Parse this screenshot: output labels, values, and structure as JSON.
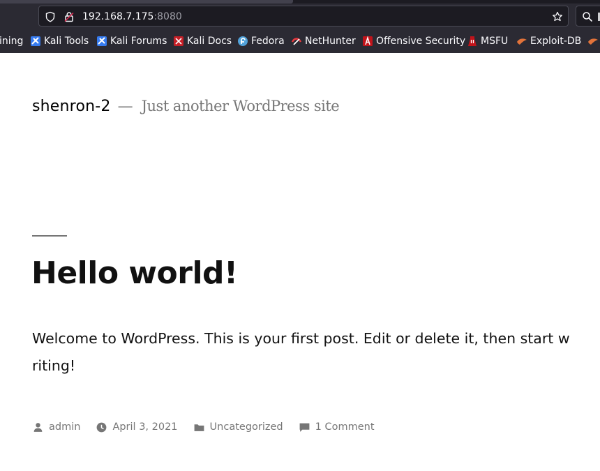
{
  "browser": {
    "url_host": "192.168.7.175",
    "url_port": ":8080",
    "bookmarks": [
      {
        "label": "ining",
        "icon": "kali-training-icon"
      },
      {
        "label": "Kali Tools",
        "icon": "kali-tools-icon"
      },
      {
        "label": "Kali Forums",
        "icon": "kali-forums-icon"
      },
      {
        "label": "Kali Docs",
        "icon": "kali-docs-icon"
      },
      {
        "label": "Fedora",
        "icon": "fedora-icon"
      },
      {
        "label": "NetHunter",
        "icon": "nethunter-icon"
      },
      {
        "label": "Offensive Security",
        "icon": "offensive-security-icon"
      },
      {
        "label": "MSFU",
        "icon": "msfu-icon"
      },
      {
        "label": "Exploit-DB",
        "icon": "exploit-db-icon"
      }
    ]
  },
  "site": {
    "title": "shenron-2",
    "separator": "—",
    "description": "Just another WordPress site"
  },
  "post": {
    "title": "Hello world!",
    "content": "Welcome to WordPress. This is your first post. Edit or delete it, then start writing!",
    "meta": {
      "author": "admin",
      "date": "April 3, 2021",
      "category": "Uncategorized",
      "comments": "1 Comment"
    }
  },
  "colors": {
    "chrome_bg": "#2b2a33",
    "field_bg": "#1c1b22",
    "meta_text": "#767676",
    "title_text": "#111111"
  }
}
